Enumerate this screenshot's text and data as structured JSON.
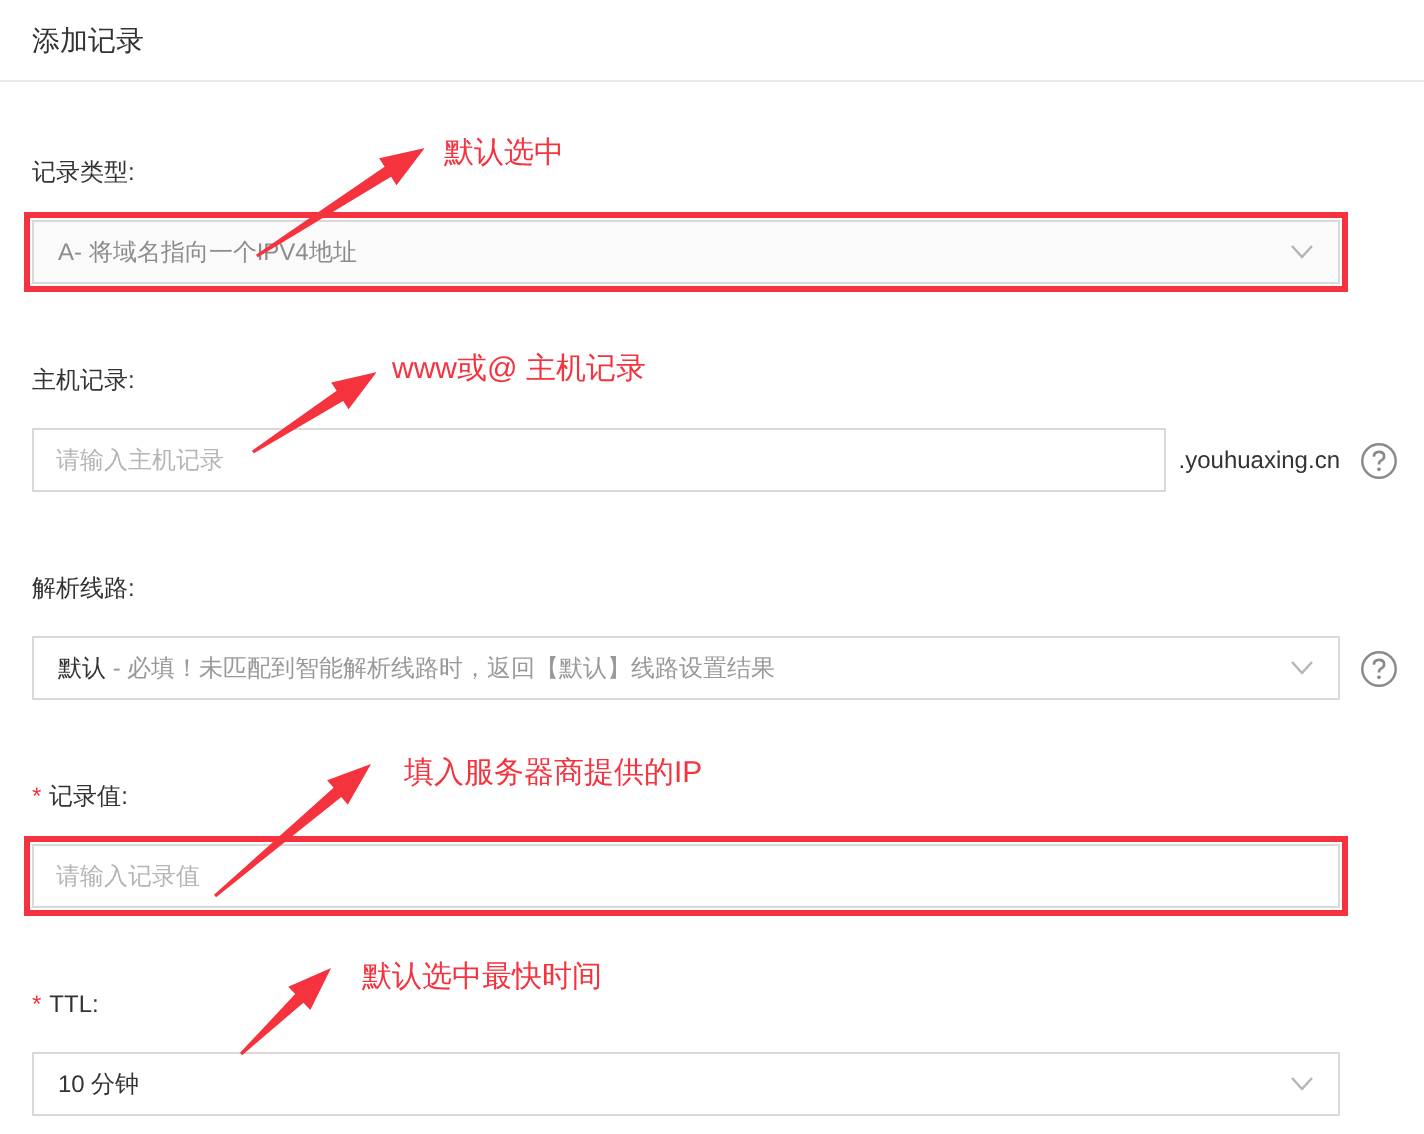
{
  "header": {
    "title": "添加记录"
  },
  "fields": [
    {
      "kind": "select",
      "label": "记录类型:",
      "value": "A- 将域名指向一个IPV4地址",
      "disabled": true,
      "highlighted": true,
      "annotation": "默认选中"
    },
    {
      "kind": "input",
      "label": "主机记录:",
      "placeholder": "请输入主机记录",
      "suffix": ".youhuaxing.cn",
      "help": true,
      "highlighted": false,
      "annotation": "www或@ 主机记录"
    },
    {
      "kind": "select",
      "label": "解析线路:",
      "value": "默认",
      "note": " - 必填！未匹配到智能解析线路时，返回【默认】线路设置结果",
      "disabled": false,
      "help": true,
      "highlighted": false
    },
    {
      "kind": "input",
      "required_mark": "*",
      "label": "记录值:",
      "placeholder": "请输入记录值",
      "highlighted": true,
      "annotation": "填入服务器商提供的IP"
    },
    {
      "kind": "select",
      "required_mark": "*",
      "label": "TTL:",
      "value": "10 分钟",
      "disabled": false,
      "highlighted": false,
      "annotation": "默认选中最快时间"
    }
  ]
}
